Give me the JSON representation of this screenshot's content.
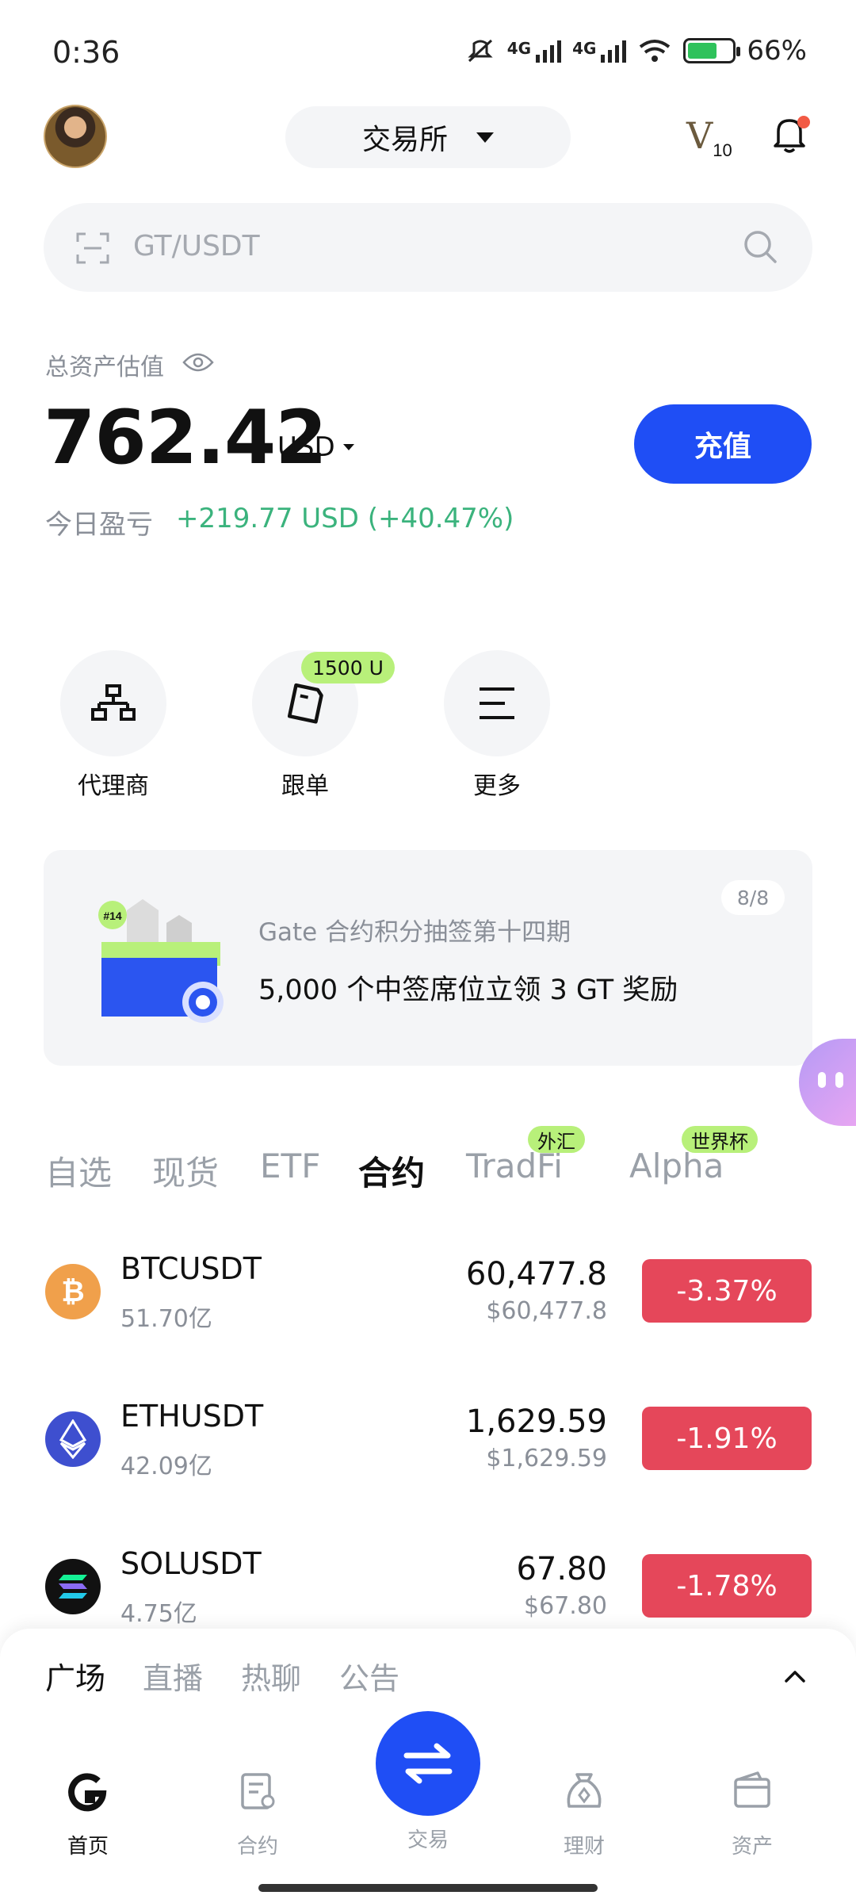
{
  "status_bar": {
    "time": "0:36",
    "network1": "4G",
    "network2": "4G",
    "battery": "66%",
    "battery_level": 0.66
  },
  "header": {
    "exchange_label": "交易所",
    "vip_letter": "V",
    "vip_level": "10"
  },
  "search": {
    "placeholder": "GT/USDT"
  },
  "assets": {
    "label": "总资产估值",
    "value": "762.42",
    "unit": "USD",
    "deposit_label": "充值",
    "pnl_label": "今日盈亏",
    "pnl_value": "+219.77 USD (+40.47%)",
    "pnl_color": "#3bb37d"
  },
  "quick_actions": [
    {
      "label": "代理商",
      "icon": "agent-icon"
    },
    {
      "label": "跟单",
      "icon": "copy-trade-icon",
      "badge": "1500 U"
    },
    {
      "label": "更多",
      "icon": "more-icon"
    }
  ],
  "banner": {
    "page": "8/8",
    "tag": "#14",
    "subtitle": "Gate 合约积分抽签第十四期",
    "title": "5,000 个中签席位立领 3 GT 奖励"
  },
  "market_tabs": [
    {
      "label": "自选"
    },
    {
      "label": "现货"
    },
    {
      "label": "ETF"
    },
    {
      "label": "合约",
      "active": true
    },
    {
      "label": "TradFi",
      "badge": "外汇"
    },
    {
      "label": "Alpha",
      "badge": "世界杯"
    }
  ],
  "markets": [
    {
      "symbol": "BTCUSDT",
      "volume": "51.70亿",
      "price": "60,477.8",
      "price_usd": "$60,477.8",
      "change": "-3.37%",
      "icon": "btc-icon",
      "color": "#f0a04b"
    },
    {
      "symbol": "ETHUSDT",
      "volume": "42.09亿",
      "price": "1,629.59",
      "price_usd": "$1,629.59",
      "change": "-1.91%",
      "icon": "eth-icon",
      "color": "#3e4fcf"
    },
    {
      "symbol": "SOLUSDT",
      "volume": "4.75亿",
      "price": "67.80",
      "price_usd": "$67.80",
      "change": "-1.78%",
      "icon": "sol-icon",
      "color": "#111111"
    }
  ],
  "sheet_tabs": [
    {
      "label": "广场",
      "active": true
    },
    {
      "label": "直播"
    },
    {
      "label": "热聊"
    },
    {
      "label": "公告"
    }
  ],
  "bottom_nav": [
    {
      "label": "首页",
      "icon": "home-icon",
      "active": true
    },
    {
      "label": "合约",
      "icon": "futures-icon"
    },
    {
      "label": "交易",
      "icon": "trade-icon"
    },
    {
      "label": "理财",
      "icon": "earn-icon"
    },
    {
      "label": "资产",
      "icon": "wallet-icon"
    }
  ],
  "colors": {
    "accent": "#1f4ef5",
    "down": "#e5475a",
    "up": "#3bb37d",
    "badge": "#b8f07a"
  }
}
